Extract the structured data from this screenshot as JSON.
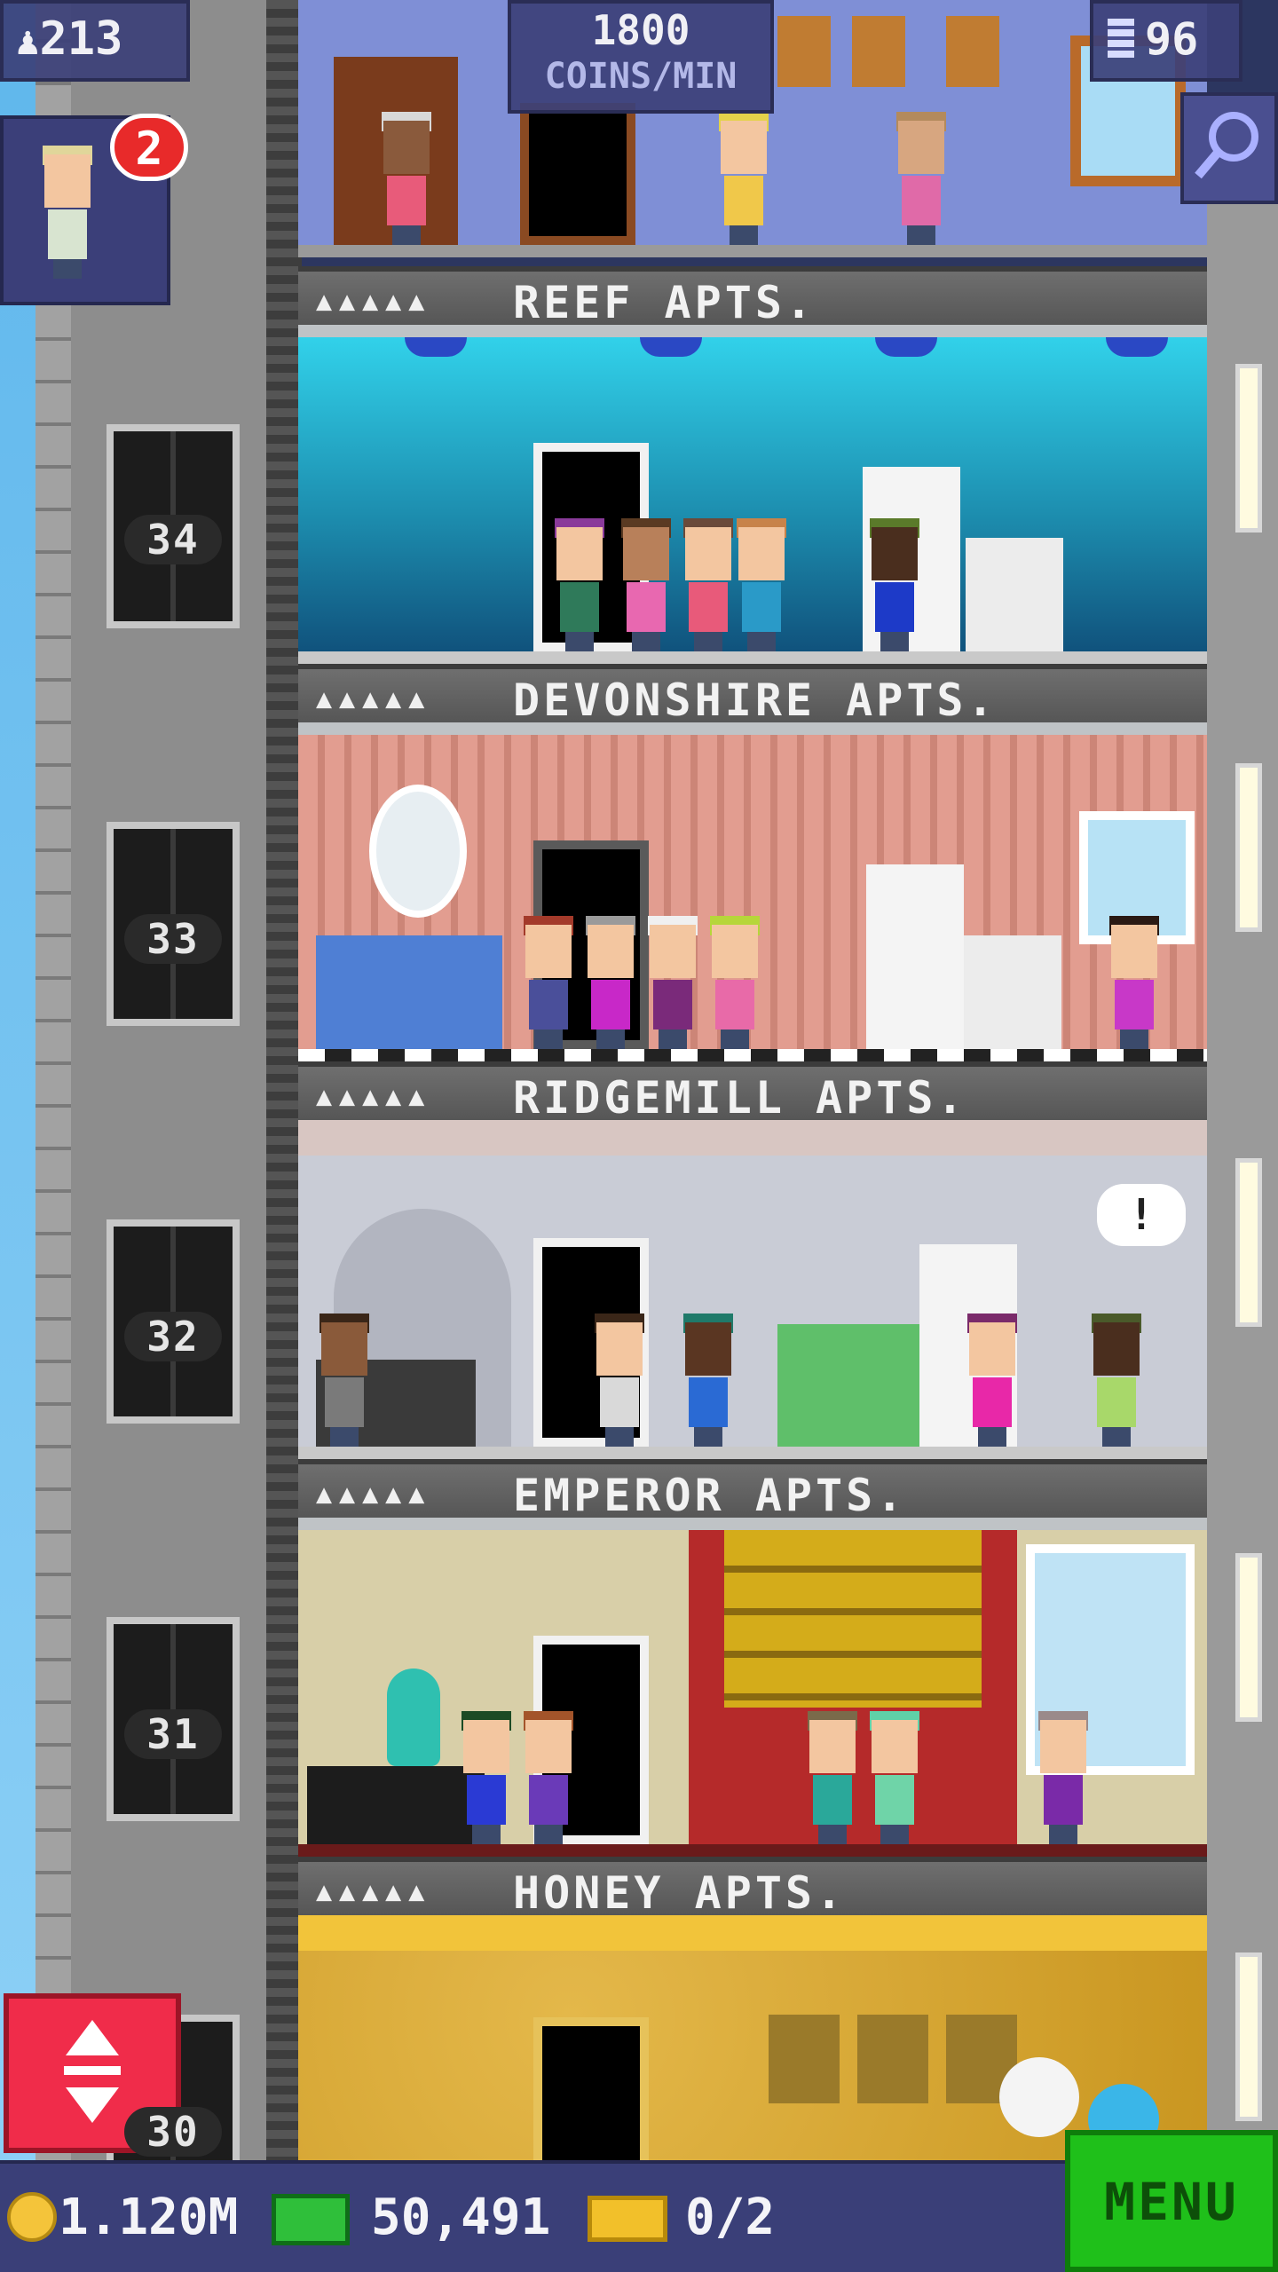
{
  "hud": {
    "population": "213",
    "coins_per_min": "1800",
    "coins_per_min_unit": "COINS/MIN",
    "floor_count": "96"
  },
  "visitor": {
    "waiting_count": "2"
  },
  "floors": [
    {
      "number": "34",
      "name": "REEF APTS.",
      "stars": "▲▲▲▲▲"
    },
    {
      "number": "33",
      "name": "DEVONSHIRE APTS.",
      "stars": "▲▲▲▲▲"
    },
    {
      "number": "32",
      "name": "RIDGEMILL APTS.",
      "stars": "▲▲▲▲▲"
    },
    {
      "number": "31",
      "name": "EMPEROR APTS.",
      "stars": "▲▲▲▲▲"
    },
    {
      "number": "30",
      "name": "HONEY APTS.",
      "stars": "▲▲▲▲▲"
    }
  ],
  "bottom_bar": {
    "coins": "1.120M",
    "bux": "50,491",
    "tickets": "0/2",
    "menu_label": "MENU"
  },
  "speech_bubble": "!",
  "icons": {
    "population": "person-icon",
    "floors": "building-icon",
    "search": "magnifier-icon",
    "elevator": "up-down-arrow-icon",
    "coins": "coin-icon",
    "bux": "banknote-icon",
    "tickets": "ticket-icon"
  },
  "colors": {
    "hud": "#3c4078",
    "menu": "#1fc01a",
    "elevator_button": "#f02c4a",
    "badge": "#e82a2a"
  }
}
